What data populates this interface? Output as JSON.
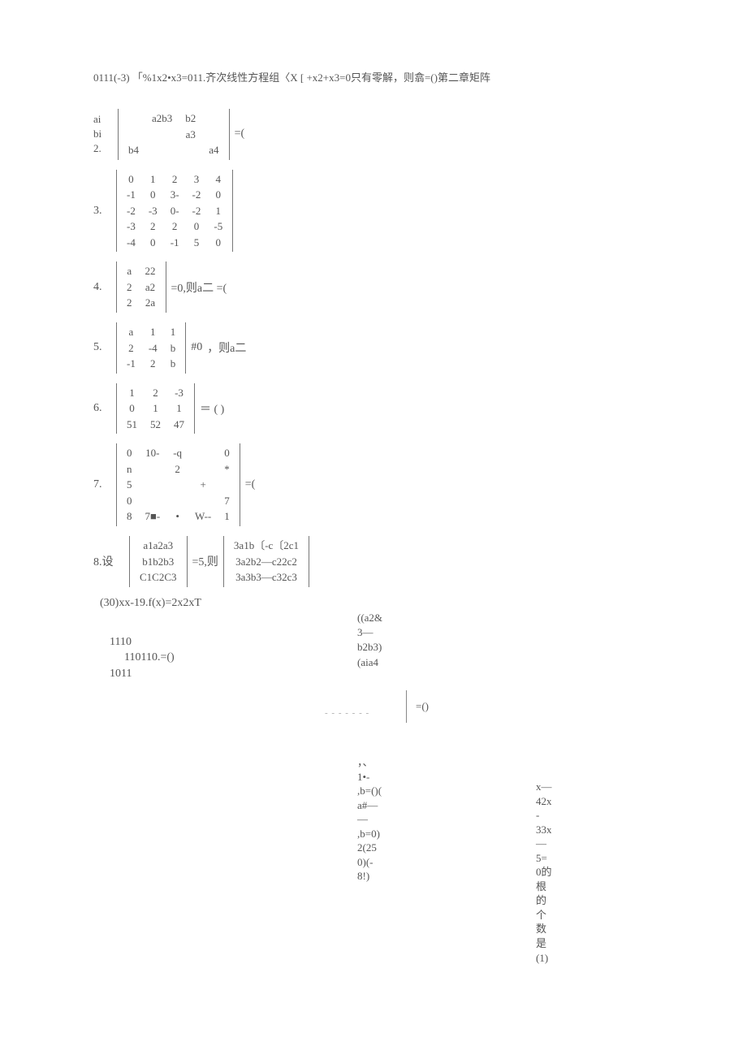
{
  "topline": "0111(-3) 「%1x2•x3=011.齐次线性方程组〈X [ +x2+x3=0只有零解，则翕=()第二章矩阵",
  "p2": {
    "left1": "ai",
    "left2": "bi",
    "left3": "2.",
    "r1c1": "",
    "r1c2": "a2b3",
    "r1c3": "b2",
    "r1c4": "",
    "r2c1": "",
    "r2c2": "",
    "r2c3": "a3",
    "r2c4": "",
    "r3c1": "b4",
    "r3c2": "",
    "r3c3": "",
    "r3c4": "a4",
    "after": "=("
  },
  "p3": {
    "label": "3.",
    "m": [
      [
        "0",
        "1",
        "2",
        "3",
        "4"
      ],
      [
        "-1",
        "0",
        "3-",
        "-2",
        "0"
      ],
      [
        "-2",
        "-3",
        "0-",
        "-2",
        "1"
      ],
      [
        "-3",
        "2",
        "2",
        "0",
        "-5"
      ],
      [
        "-4",
        "0",
        "-1",
        "5",
        "0"
      ]
    ]
  },
  "p4": {
    "label": "4.",
    "m": [
      [
        "a",
        "22"
      ],
      [
        "2",
        "a2"
      ],
      [
        "2",
        "2a"
      ]
    ],
    "after": "=0,则a二  =("
  },
  "p5": {
    "label": "5.",
    "m": [
      [
        "a",
        "1",
        "1"
      ],
      [
        "2",
        "-4",
        "b"
      ],
      [
        "-1",
        "2",
        "b"
      ]
    ],
    "mid": "#0",
    "after": "，则a二"
  },
  "p6": {
    "label": "6.",
    "m": [
      [
        "1",
        "2",
        "-3"
      ],
      [
        "0",
        "1",
        "1"
      ],
      [
        "51",
        "52",
        "47"
      ]
    ],
    "after": "＝  (  )"
  },
  "p7": {
    "label": "7.",
    "m": [
      [
        "0",
        "10-",
        "-q",
        "",
        "0"
      ],
      [
        "n",
        "",
        "2",
        "",
        "*"
      ],
      [
        "5",
        "",
        "",
        "+",
        ""
      ],
      [
        "0",
        "",
        "",
        "",
        "7"
      ],
      [
        "8",
        "7■-",
        "•",
        "W--",
        "1"
      ]
    ],
    "after": "=("
  },
  "p8": {
    "label": "8.设",
    "m1": [
      [
        "a1a2a3"
      ],
      [
        "b1b2b3"
      ],
      [
        "C1C2C3"
      ]
    ],
    "mid": "=5,则",
    "m2": [
      [
        "3a1b〔-c〔2c1"
      ],
      [
        "3a2b2—c22c2"
      ],
      [
        "3a3b3—c32c3"
      ]
    ],
    "after": "=()"
  },
  "line30": "(30)xx-19.f(x)=2x2xT",
  "b1110": {
    "l1": "1110",
    "l2": "110110.=()",
    "l3": "1011"
  },
  "rc1": {
    "l1": "((a2&",
    "l2": "3—",
    "l3": "b2b3)",
    "l4": "(aia4"
  },
  "rc2": {
    "l1": "，、",
    "l2": "1•-",
    "l3": ",b=()(",
    "l4": "a#—",
    "l5": "—",
    "l6": ",b=0)",
    "l7": "2(25",
    "l8": "0)(-",
    "l9": "8!)"
  },
  "rc3": {
    "l1": "x—",
    "l2": "42x",
    "l3": "-",
    "l4": "33x",
    "l5": "—",
    "l6": "5=",
    "l7": "0的",
    "l8": "根",
    "l9": "的",
    "l10": "个",
    "l11": "数",
    "l12": "是",
    "l13": "(1)"
  },
  "dot": "- - - - - - -"
}
